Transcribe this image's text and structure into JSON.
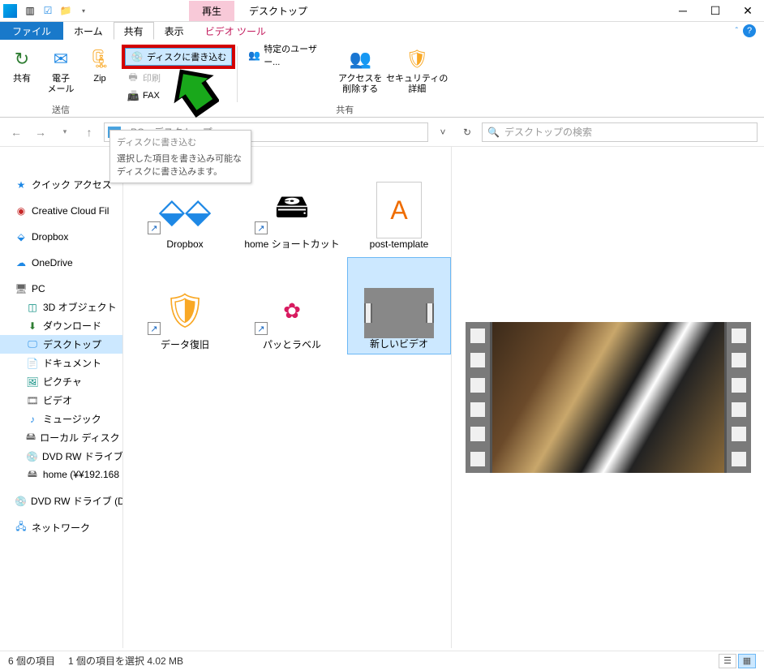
{
  "titlebar": {
    "playback_tab": "再生",
    "title": "デスクトップ"
  },
  "tabs": {
    "file": "ファイル",
    "home": "ホーム",
    "share": "共有",
    "view": "表示",
    "video_tools": "ビデオ ツール"
  },
  "ribbon": {
    "share_btn": "共有",
    "email_btn": "電子\nメール",
    "zip_btn": "Zip",
    "burn_disc": "ディスクに書き込む",
    "print": "印刷",
    "fax": "FAX",
    "send_group": "送信",
    "specific_users": "特定のユーザー...",
    "remove_access": "アクセスを\n削除する",
    "security_detail": "セキュリティの\n詳細",
    "share_group": "共有"
  },
  "tooltip": {
    "title": "ディスクに書き込む",
    "body": "選択した項目を書き込み可能なディスクに書き込みます。"
  },
  "addressbar": {
    "path1": "PC",
    "path2": "デスクトップ"
  },
  "search": {
    "placeholder": "デスクトップの検索"
  },
  "nav": {
    "quick_access": "クイック アクセス",
    "creative_cloud": "Creative Cloud Fil",
    "dropbox": "Dropbox",
    "onedrive": "OneDrive",
    "pc": "PC",
    "objects3d": "3D オブジェクト",
    "downloads": "ダウンロード",
    "desktop": "デスクトップ",
    "documents": "ドキュメント",
    "pictures": "ピクチャ",
    "videos": "ビデオ",
    "music": "ミュージック",
    "local_disk": "ローカル ディスク (C",
    "dvd_rw": "DVD RW ドライブ",
    "home_share": "home (¥¥192.168",
    "dvd_rw2": "DVD RW ドライブ (D",
    "network": "ネットワーク"
  },
  "items": {
    "dropbox": "Dropbox",
    "home_shortcut": "home  ショートカット",
    "post_template": "post-template",
    "data_recovery": "データ復旧",
    "patto_label": "パッとラベル",
    "new_video": "新しいビデオ"
  },
  "status": {
    "count": "6 個の項目",
    "selection": "1 個の項目を選択  4.02 MB"
  }
}
